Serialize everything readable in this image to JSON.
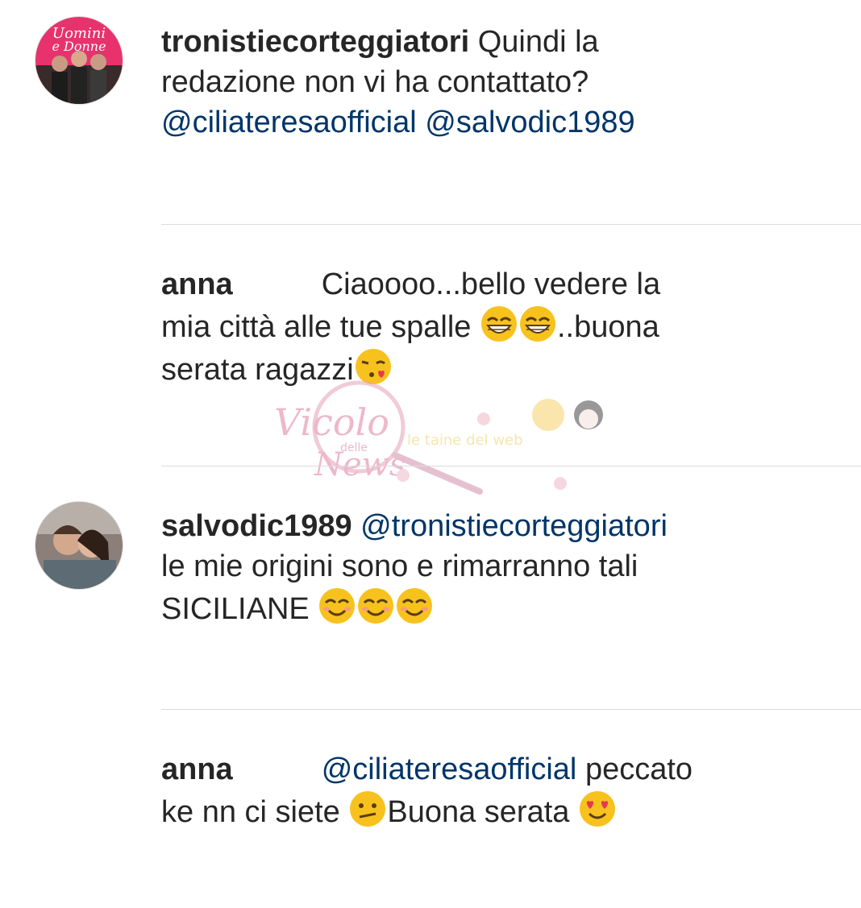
{
  "comments": [
    {
      "username": "tronistiecorteggiatori",
      "line1_text": " Quindi la",
      "line2_text": "redazione non vi ha contattato?",
      "mention_a": "@ciliateresaofficial",
      "mention_b": "@salvodic1989",
      "avatar_icon": "uomini-e-donne-logo"
    },
    {
      "username": "anna",
      "line1_text": "Ciaoooo...bello vedere la",
      "line2_text": "mia città alle tue spalle ",
      "line2_end": "..buona",
      "line3_text": "serata ragazzi",
      "emojis": [
        "grinning-face-icon",
        "grinning-face-icon",
        "face-blowing-kiss-icon"
      ]
    },
    {
      "username": "salvodic1989",
      "mention": "@tronistiecorteggiatori",
      "line2_text": "le mie origini sono e rimarranno tali",
      "line3_text": "SICILIANE ",
      "emojis": [
        "smiling-face-icon",
        "smiling-face-icon",
        "smiling-face-icon"
      ]
    },
    {
      "username": "anna",
      "mention": "@ciliateresaofficial",
      "line1_end": " peccato",
      "line2_text": "ke nn ci siete ",
      "line2_end": "Buona serata ",
      "emojis": [
        "confused-face-icon",
        "heart-eyes-face-icon"
      ]
    }
  ],
  "watermark": {
    "text_main": "Vicolo",
    "text_small": "delle",
    "text_news": "News",
    "text_tagline": "le taine del web"
  },
  "colors": {
    "text": "#262626",
    "mention": "#003569",
    "divider": "#dbdbdb",
    "emoji_yellow": "#f7c21e",
    "watermark_pink": "#e8a0b8"
  }
}
